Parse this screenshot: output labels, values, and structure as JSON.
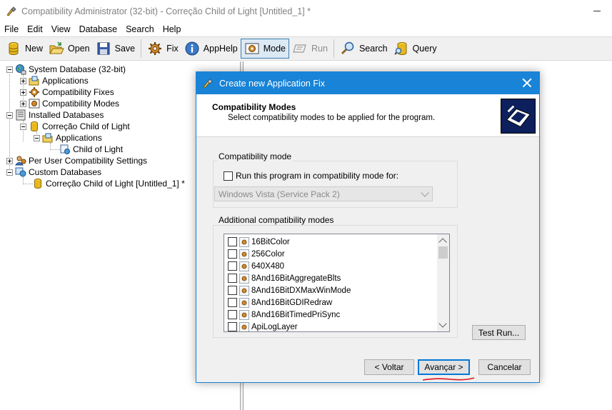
{
  "window": {
    "title": "Compatibility Administrator (32-bit) - Correção  Child of Light [Untitled_1] *"
  },
  "menu": [
    "File",
    "Edit",
    "View",
    "Database",
    "Search",
    "Help"
  ],
  "toolbar": {
    "new": "New",
    "open": "Open",
    "save": "Save",
    "fix": "Fix",
    "apphelp": "AppHelp",
    "mode": "Mode",
    "run": "Run",
    "search": "Search",
    "query": "Query"
  },
  "tree": {
    "system_db": "System Database (32-bit)",
    "applications": "Applications",
    "compat_fixes": "Compatibility Fixes",
    "compat_modes": "Compatibility Modes",
    "installed_dbs": "Installed Databases",
    "installed_correcao": "Correção Child of Light",
    "installed_applications": "Applications",
    "child_of_light": "Child of Light",
    "per_user": "Per User Compatibility Settings",
    "custom_dbs": "Custom Databases",
    "custom_correcao": "Correção  Child of Light [Untitled_1] *"
  },
  "dialog": {
    "title": "Create new Application Fix",
    "header_title": "Compatibility Modes",
    "header_subtitle": "Select compatibility modes to be applied for the program.",
    "group_mode_label": "Compatibility mode",
    "run_in_mode_label": "Run this program in compatibility mode for:",
    "os_selected": "Windows Vista (Service Pack 2)",
    "group_additional_label": "Additional compatibility modes",
    "modes": [
      "16BitColor",
      "256Color",
      "640X480",
      "8And16BitAggregateBlts",
      "8And16BitDXMaxWinMode",
      "8And16BitGDIRedraw",
      "8And16BitTimedPriSync",
      "ApiLogLayer"
    ],
    "test_run": "Test Run...",
    "back": "< Voltar",
    "next": "Avançar >",
    "cancel": "Cancelar"
  },
  "colors": {
    "dialog_title_bg": "#1883d7",
    "annotation_red": "#e0141e",
    "db_yellow": "#e8b820"
  }
}
